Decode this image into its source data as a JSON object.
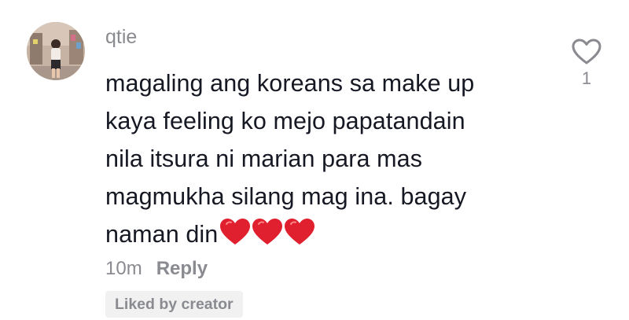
{
  "comment": {
    "username": "qtie",
    "text_lines": [
      "magaling ang koreans sa make up",
      "kaya feeling ko mejo papatandain",
      "nila itsura ni marian para mas",
      "magmukha silang mag ina. bagay",
      "naman din"
    ],
    "emoji_icons": [
      "red-heart-icon",
      "red-heart-icon",
      "red-heart-icon"
    ],
    "timestamp": "10m",
    "reply_label": "Reply",
    "liked_badge": "Liked by creator",
    "like_count": "1"
  },
  "colors": {
    "text_primary": "#161823",
    "text_secondary": "#8a8b91",
    "badge_bg": "#f1f1f2",
    "heart_emoji": "#e0202e"
  }
}
